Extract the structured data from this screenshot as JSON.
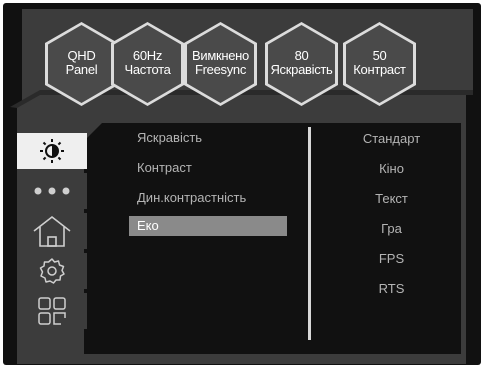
{
  "status_badges": [
    {
      "line1": "QHD",
      "line2": "Panel"
    },
    {
      "line1": "60Hz",
      "line2": "Частота"
    },
    {
      "line1": "Вимкнено",
      "line2": "Freesync"
    },
    {
      "line1": "80",
      "line2": "Яскравість"
    },
    {
      "line1": "50",
      "line2": "Контраст"
    }
  ],
  "sidebar": [
    {
      "icon": "brightness-icon",
      "active": true
    },
    {
      "icon": "more-dots-icon",
      "active": false
    },
    {
      "icon": "home-icon",
      "active": false
    },
    {
      "icon": "settings-gear-icon",
      "active": false
    },
    {
      "icon": "grid-icon",
      "active": false
    }
  ],
  "menu": {
    "items": [
      "Яскравість",
      "Контраст",
      "Дин.контрастність",
      "Еко"
    ],
    "selected": "Еко"
  },
  "eco_options": [
    "Стандарт",
    "Кіно",
    "Текст",
    "Гра",
    "FPS",
    "RTS"
  ],
  "colors": {
    "background": "#111111",
    "panel": "#3c3c3c",
    "active_sidebar": "#efefef",
    "selected_item": "#8a8a8a",
    "text": "#b4b4b4"
  }
}
